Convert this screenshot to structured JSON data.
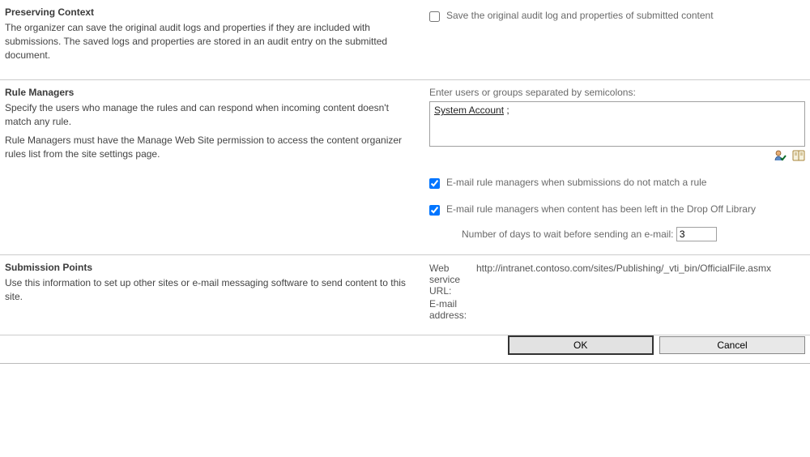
{
  "sections": {
    "preserving": {
      "title": "Preserving Context",
      "desc": "The organizer can save the original audit logs and properties if they are included with submissions. The saved logs and properties are stored in an audit entry on the submitted document.",
      "checkbox_label": "Save the original audit log and properties of submitted content"
    },
    "rule_managers": {
      "title": "Rule Managers",
      "desc1": "Specify the users who manage the rules and can respond when incoming content doesn't match any rule.",
      "desc2": "Rule Managers must have the Manage Web Site permission to access the content organizer rules list from the site settings page.",
      "people_label": "Enter users or groups separated by semicolons:",
      "people_value": "System Account ;",
      "cb1_label": "E-mail rule managers when submissions do not match a rule",
      "cb2_label": "E-mail rule managers when content has been left in the Drop Off Library",
      "days_label": "Number of days to wait before sending an e-mail:",
      "days_value": "3"
    },
    "submission": {
      "title": "Submission Points",
      "desc": "Use this information to set up other sites or e-mail messaging software to send content to this site.",
      "web_label": "Web service URL:",
      "web_value": "http://intranet.contoso.com/sites/Publishing/_vti_bin/OfficialFile.asmx",
      "email_label": "E-mail address:",
      "email_value": ""
    }
  },
  "buttons": {
    "ok": "OK",
    "cancel": "Cancel"
  }
}
